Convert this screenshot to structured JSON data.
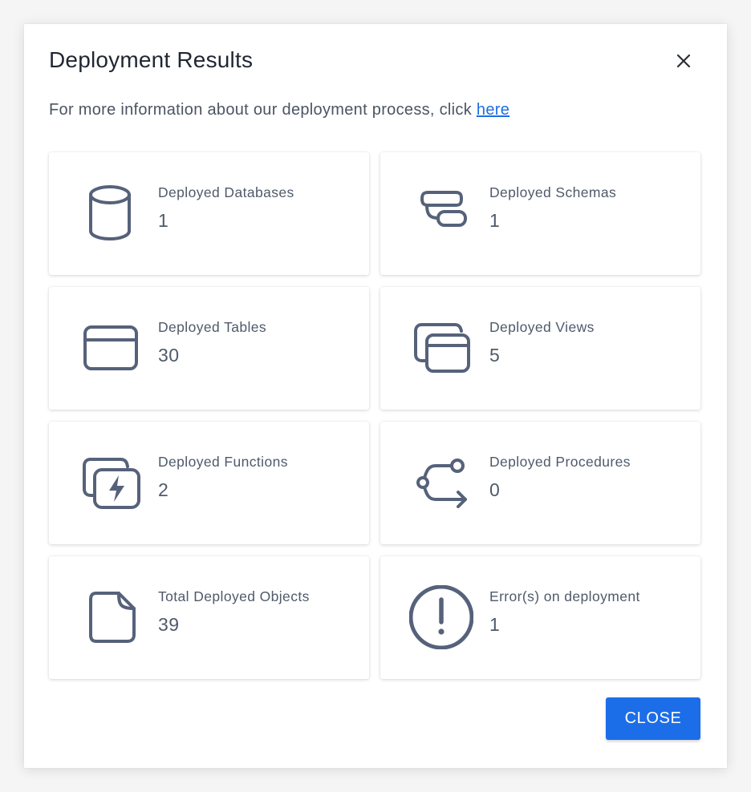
{
  "dialog": {
    "title": "Deployment Results",
    "info_text": "For more information about our deployment process, click ",
    "info_link": "here",
    "close_button": "CLOSE"
  },
  "cards": [
    {
      "label": "Deployed Databases",
      "value": "1",
      "icon": "database-icon"
    },
    {
      "label": "Deployed Schemas",
      "value": "1",
      "icon": "schema-icon"
    },
    {
      "label": "Deployed Tables",
      "value": "30",
      "icon": "table-icon"
    },
    {
      "label": "Deployed Views",
      "value": "5",
      "icon": "views-icon"
    },
    {
      "label": "Deployed Functions",
      "value": "2",
      "icon": "function-icon"
    },
    {
      "label": "Deployed Procedures",
      "value": "0",
      "icon": "procedure-icon"
    },
    {
      "label": "Total Deployed Objects",
      "value": "39",
      "icon": "file-icon"
    },
    {
      "label": "Error(s) on deployment",
      "value": "1",
      "icon": "error-icon"
    }
  ],
  "colors": {
    "accent": "#1c6ee8",
    "link": "#1f6fe0",
    "icon": "#56627a",
    "text": "#4f5a6a"
  }
}
